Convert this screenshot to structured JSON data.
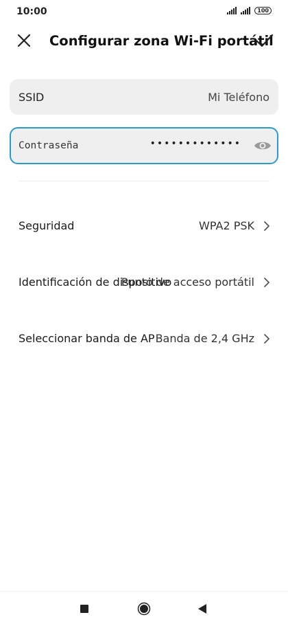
{
  "status_bar": {
    "time": "10:00",
    "battery": "100"
  },
  "header": {
    "title": "Configurar zona Wi-Fi portátil",
    "close_icon": "close-icon",
    "confirm_icon": "check-icon"
  },
  "fields": {
    "ssid": {
      "label": "SSID",
      "value": "Mi Teléfono"
    },
    "password": {
      "label": "Contraseña",
      "value_masked": "•••••••••••••",
      "toggle_icon": "eye-icon",
      "accent_color": "#2a9ad6"
    }
  },
  "settings": [
    {
      "label": "Seguridad",
      "value": "WPA2 PSK"
    },
    {
      "label": "Identificación de dispositivo",
      "value": "Punto de acceso portátil"
    },
    {
      "label": "Seleccionar banda de AP",
      "value": "Banda de 2,4 GHz"
    }
  ],
  "nav_bar": {
    "recent_icon": "square-icon",
    "home_icon": "circle-icon",
    "back_icon": "triangle-back-icon"
  }
}
